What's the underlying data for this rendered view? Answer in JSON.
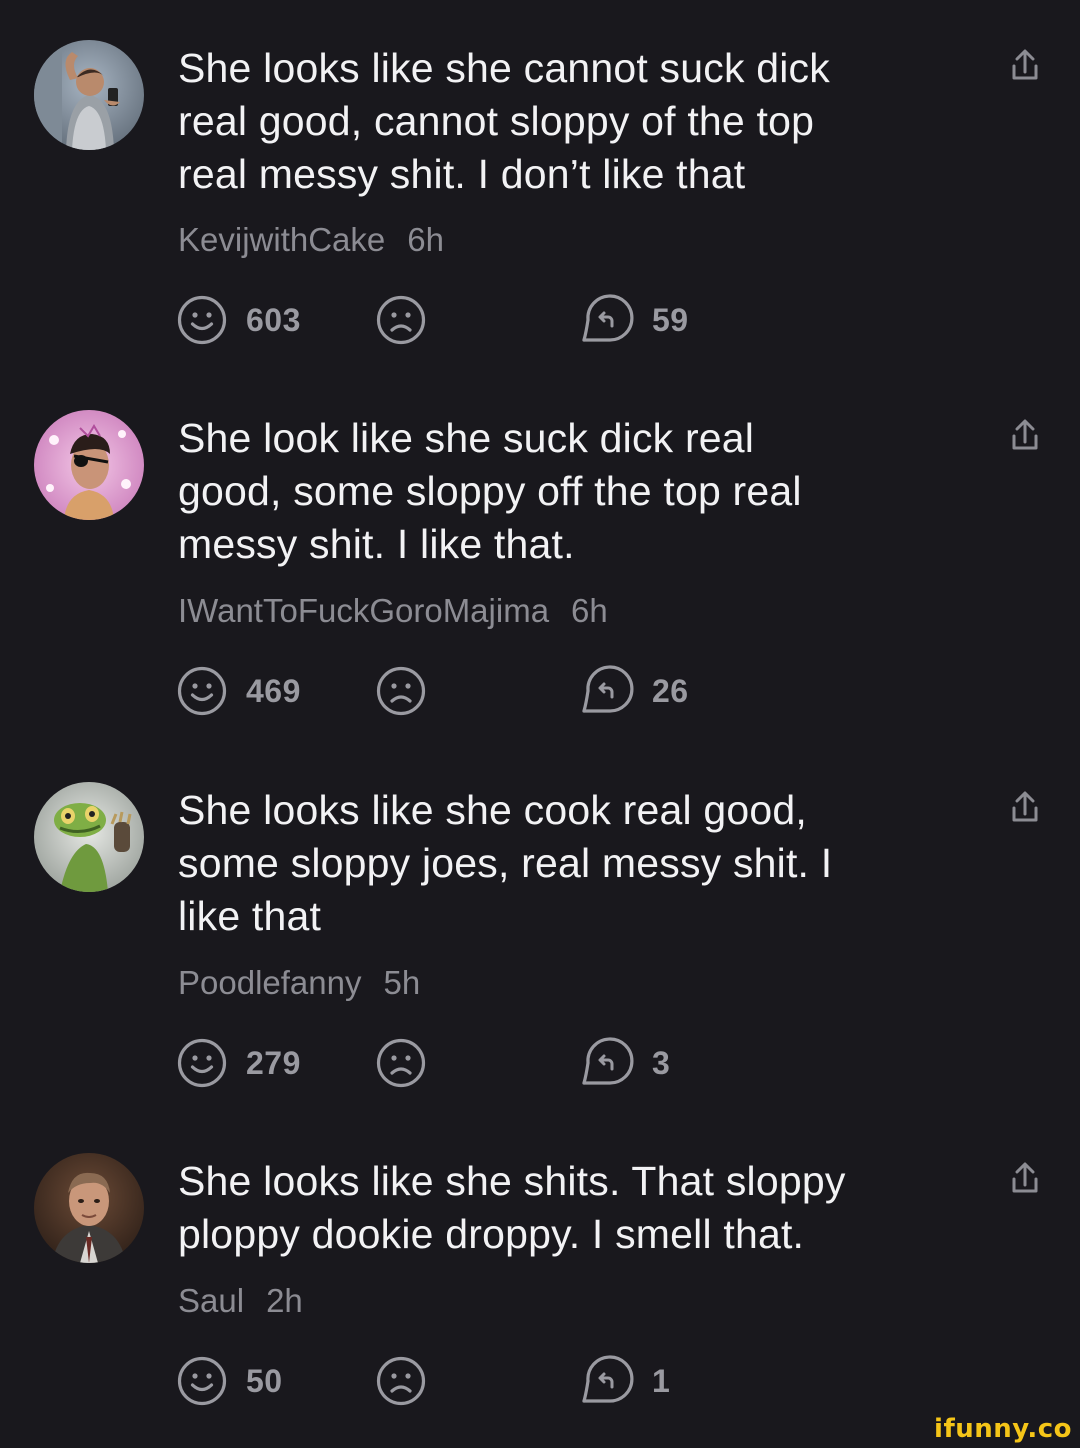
{
  "comments": [
    {
      "avatar": "man-mirror-selfie-avatar",
      "text_lines": [
        "She looks like she cannot suck dick",
        "real good, cannot sloppy of the top",
        "real messy shit. I don’t like that"
      ],
      "username": "KevijwithCake",
      "time": "6h",
      "likes": "603",
      "replies": "59"
    },
    {
      "avatar": "eyepatch-man-pink-avatar",
      "text_lines": [
        "She look like she suck dick real",
        "good, some sloppy off the top real",
        "messy shit. I like that."
      ],
      "username": "IWantToFuckGoroMajima",
      "time": "6h",
      "likes": "469",
      "replies": "26"
    },
    {
      "avatar": "gecko-avatar",
      "text_lines": [
        "She looks like she cook real good,",
        "some sloppy joes, real messy shit. I",
        "like that"
      ],
      "username": "Poodlefanny",
      "time": "5h",
      "likes": "279",
      "replies": "3"
    },
    {
      "avatar": "man-in-suit-avatar",
      "text_lines": [
        "She looks like she shits. That sloppy",
        "ploppy dookie droppy. I smell that."
      ],
      "username": "Saul",
      "time": "2h",
      "likes": "50",
      "replies": "1"
    }
  ],
  "icons": {
    "share": "share-icon",
    "like": "smile-icon",
    "dislike": "frown-icon",
    "reply": "reply-icon"
  },
  "colors": {
    "background": "#19181d",
    "text": "#f2f2f4",
    "secondary": "#8c8c93",
    "watermark": "#f5c518"
  },
  "watermark": "ifunny.co"
}
